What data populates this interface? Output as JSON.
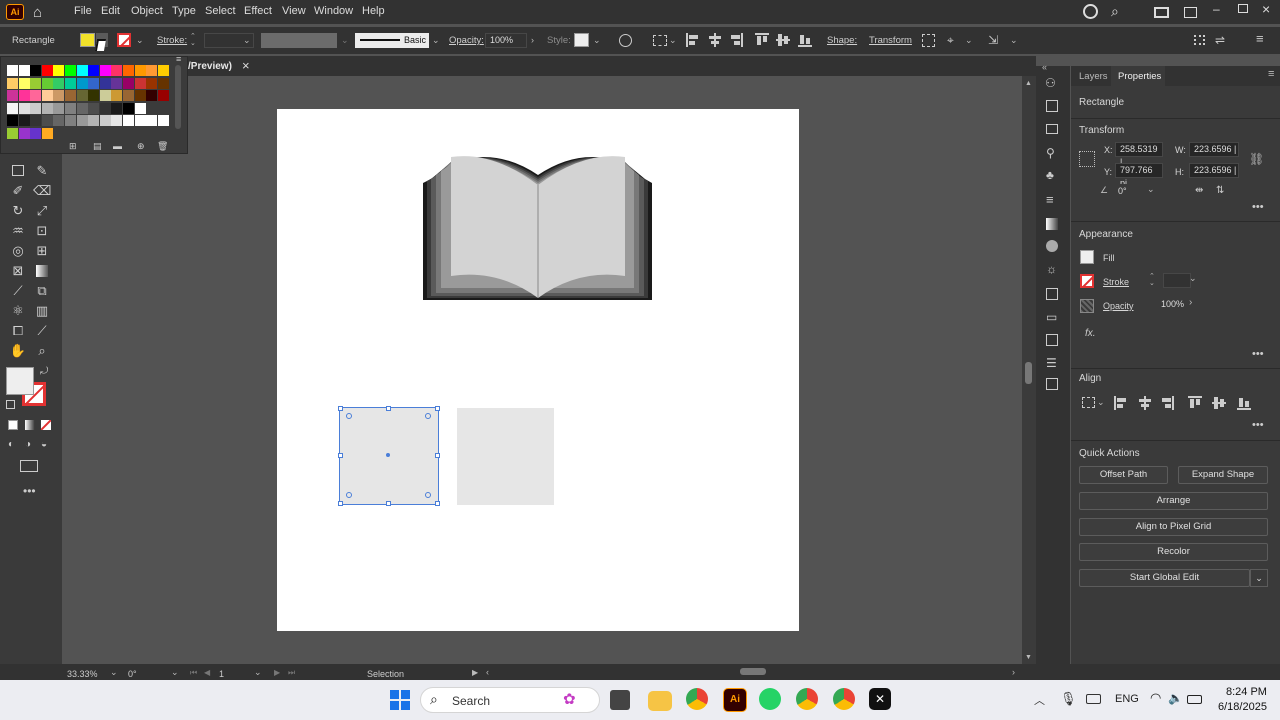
{
  "menubar": {
    "logo": "Ai",
    "items": [
      "File",
      "Edit",
      "Object",
      "Type",
      "Select",
      "Effect",
      "View",
      "Window",
      "Help"
    ]
  },
  "control": {
    "object_type": "Rectangle",
    "stroke_label": "Stroke:",
    "brush_label": "Basic",
    "opacity_label": "Opacity:",
    "opacity_value": "100%",
    "style_label": "Style:",
    "shape_label": "Shape:",
    "transform_label": "Transform"
  },
  "tab": {
    "title": "/Preview)",
    "close": "×"
  },
  "panels": {
    "tabs": [
      "Layers",
      "Properties"
    ],
    "active": "Properties"
  },
  "properties": {
    "object_type": "Rectangle",
    "transform": {
      "header": "Transform",
      "x_label": "X:",
      "x_value": "258.5319 |",
      "y_label": "Y:",
      "y_value": "797.766 pi",
      "w_label": "W:",
      "w_value": "223.6596 |",
      "h_label": "H:",
      "h_value": "223.6596 |",
      "angle_value": "0°"
    },
    "appearance": {
      "header": "Appearance",
      "fill_label": "Fill",
      "stroke_label": "Stroke",
      "opacity_label": "Opacity",
      "opacity_value": "100%",
      "fx_label": "fx."
    },
    "align": {
      "header": "Align"
    },
    "quick_actions": {
      "header": "Quick Actions",
      "offset_path": "Offset Path",
      "expand_shape": "Expand Shape",
      "arrange": "Arrange",
      "align_pixel": "Align to Pixel Grid",
      "recolor": "Recolor",
      "global_edit": "Start Global Edit"
    }
  },
  "status": {
    "zoom": "33.33%",
    "rotation": "0°",
    "artboard_num": "1",
    "tool": "Selection"
  },
  "taskbar": {
    "search_label": "Search",
    "lang": "ENG",
    "time": "8:24 PM",
    "date": "6/18/2025"
  },
  "colors": {
    "accent": "#4a7ed8",
    "fill_yellow": "#f2e22a",
    "stroke_red": "#e23232"
  }
}
